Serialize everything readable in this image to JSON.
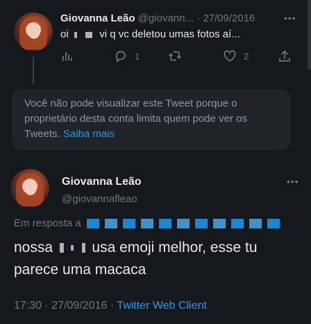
{
  "tweet1": {
    "name": "Giovanna Leão",
    "handle": "@giovann...",
    "separator": "·",
    "date": "27/09/2016",
    "text_pre": "oi",
    "text_post": "vi q vc deletou umas fotos aí...",
    "reply_count": "1",
    "like_count": "2"
  },
  "unavailable": {
    "message": "Você não pode visualizar este Tweet porque o proprietário desta conta limita quem pode ver os Tweets.",
    "link": "Saiba mais"
  },
  "tweet2": {
    "name": "Giovanna Leão",
    "handle": "@giovannafleao",
    "reply_label": "Em resposta a",
    "text_pre": "nossa",
    "text_post": "usa emoji melhor, esse tu parece uma macaca",
    "time": "17:30",
    "separator": "·",
    "date": "27/09/2016",
    "source": "Twitter Web Client"
  },
  "colors": {
    "accent": "#1d9bf0",
    "background": "#15181c",
    "muted": "#71767b"
  }
}
